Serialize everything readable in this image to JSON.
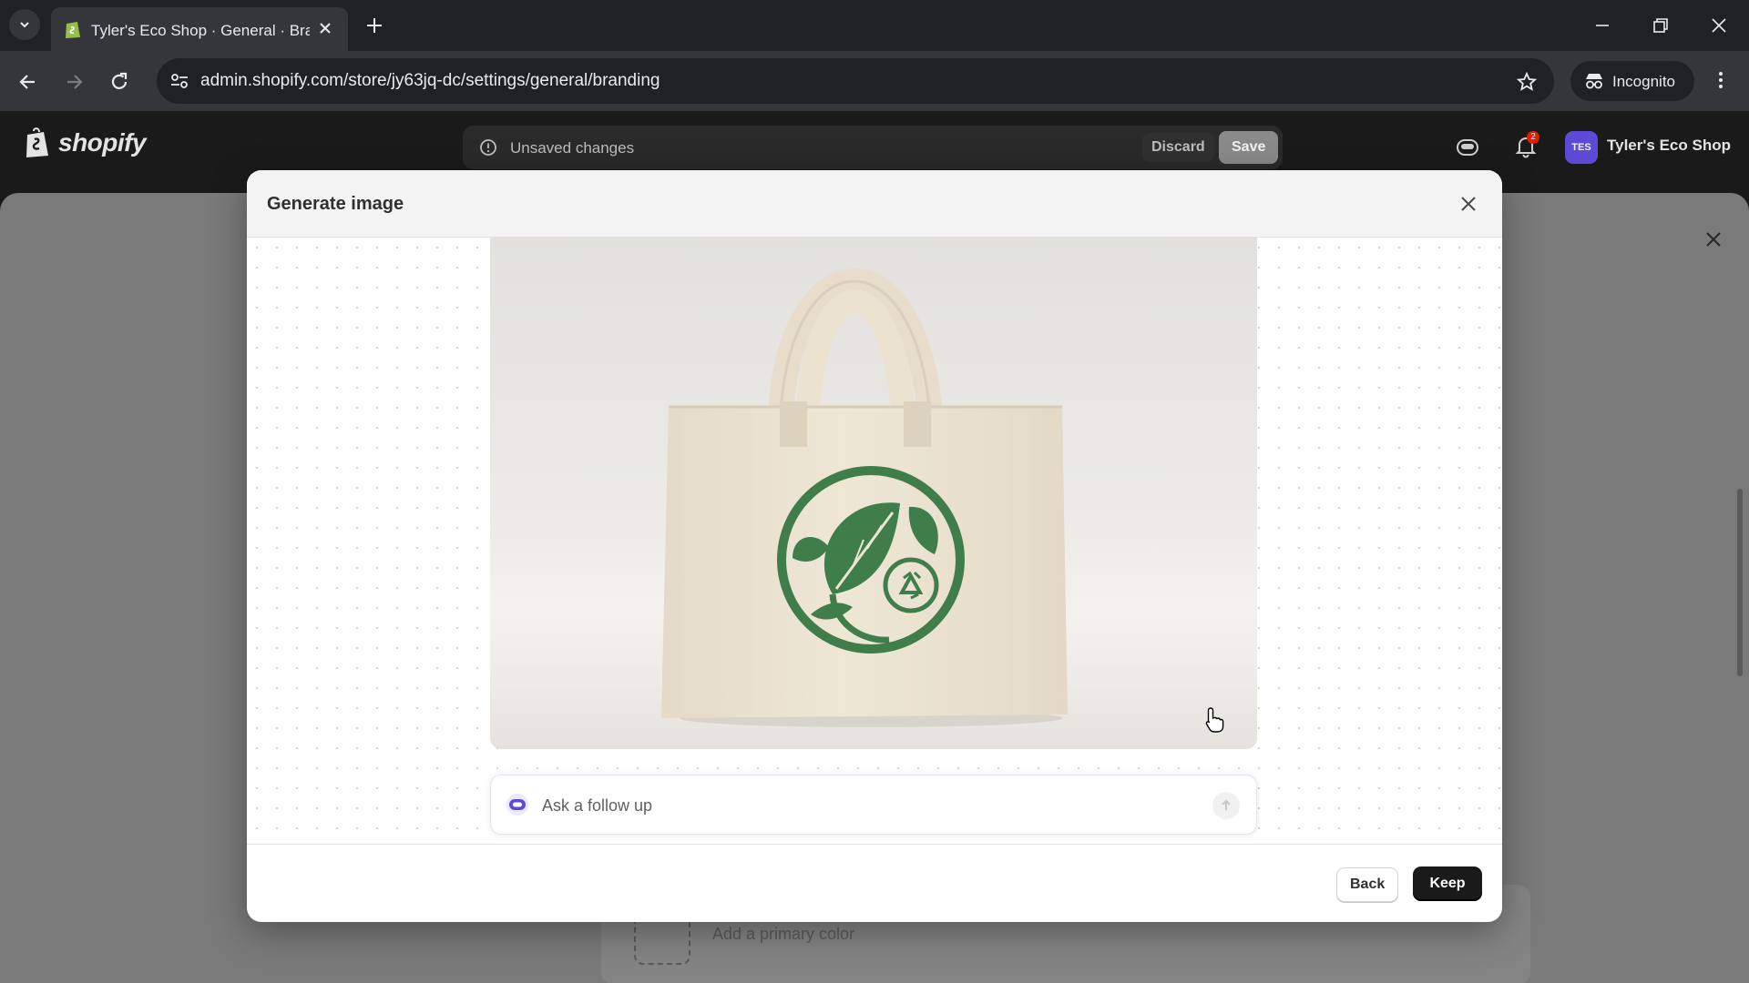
{
  "browser": {
    "tab_title": "Tyler's Eco Shop · General · Branding",
    "url": "admin.shopify.com/store/jy63jq-dc/settings/general/branding",
    "incognito_label": "Incognito"
  },
  "admin_bar": {
    "logo_text": "shopify",
    "unsaved_text": "Unsaved changes",
    "discard_label": "Discard",
    "save_label": "Save",
    "notification_count": "2",
    "avatar_initials": "TES",
    "store_name": "Tyler's Eco Shop"
  },
  "background_page": {
    "primary_color_label": "Add a primary color"
  },
  "modal": {
    "title": "Generate image",
    "followup_placeholder": "Ask a follow up",
    "back_label": "Back",
    "keep_label": "Keep"
  },
  "colors": {
    "brand_green": "#3f7d4a",
    "tote_canvas": "#ede4d3",
    "primary_button": "#1a1a1a",
    "avatar_purple": "#5c4ad6"
  }
}
